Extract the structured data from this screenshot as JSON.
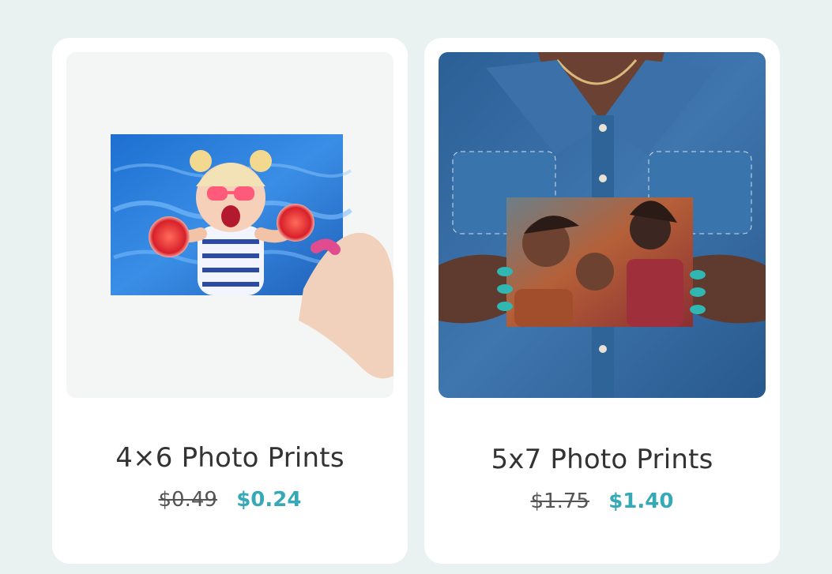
{
  "colors": {
    "page_background": "#e9f1f1",
    "sale_price": "#36a9b7"
  },
  "products": [
    {
      "title": "4×6 Photo Prints",
      "original_price": "$0.49",
      "sale_price": "$0.24"
    },
    {
      "title": "5x7 Photo Prints",
      "original_price": "$1.75",
      "sale_price": "$1.40"
    }
  ]
}
